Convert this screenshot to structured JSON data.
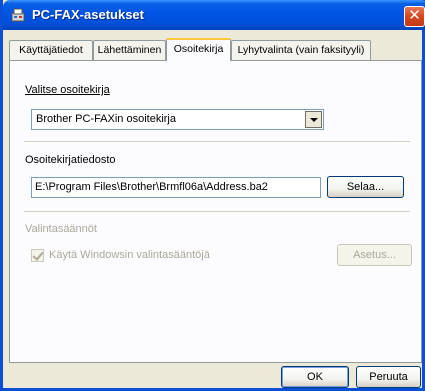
{
  "window": {
    "title": "PC-FAX-asetukset",
    "close_glyph": "✕",
    "app_icon": "pc-fax-icon",
    "accent": "#0055e5"
  },
  "tabs": [
    {
      "label": "Käyttäjätiedot",
      "active": false
    },
    {
      "label": "Lähettäminen",
      "active": false
    },
    {
      "label": "Osoitekirja",
      "active": true
    },
    {
      "label": "Lyhytvalinta (vain faksityyli)",
      "active": false
    }
  ],
  "addressbook": {
    "select_label": "Valitse osoitekirja",
    "select_value": "Brother PC-FAXin osoitekirja",
    "file_label": "Osoitekirjatiedosto",
    "file_value": "E:\\Program Files\\Brother\\Brmfl06a\\Address.ba2",
    "browse_button": "Selaa..."
  },
  "dialing_rules": {
    "group_label": "Valintasäännöt",
    "checkbox_label": "Käytä Windowsin valintasääntöjä",
    "checkbox_checked": true,
    "settings_button": "Asetus..."
  },
  "footer": {
    "ok_button": "OK",
    "cancel_button": "Peruuta"
  }
}
